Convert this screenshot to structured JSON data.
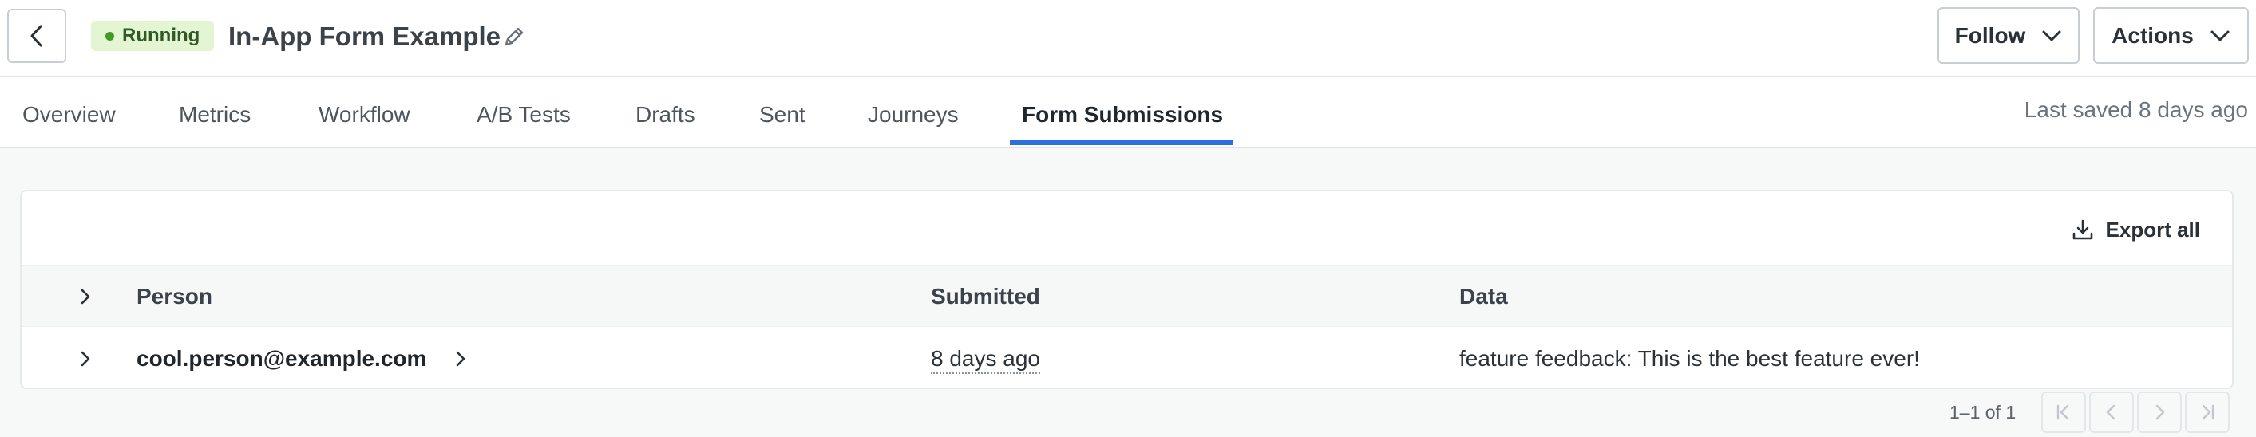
{
  "header": {
    "status": "Running",
    "title": "In-App Form Example",
    "follow_label": "Follow",
    "actions_label": "Actions"
  },
  "tabs": [
    {
      "label": "Overview"
    },
    {
      "label": "Metrics"
    },
    {
      "label": "Workflow"
    },
    {
      "label": "A/B Tests"
    },
    {
      "label": "Drafts"
    },
    {
      "label": "Sent"
    },
    {
      "label": "Journeys"
    },
    {
      "label": "Form Submissions",
      "active": true
    }
  ],
  "last_saved": "Last saved 8 days ago",
  "card": {
    "export_label": "Export all",
    "columns": [
      "Person",
      "Submitted",
      "Data"
    ],
    "rows": [
      {
        "person": "cool.person@example.com",
        "submitted": "8 days ago",
        "data": "feature feedback: This is the best feature ever!"
      }
    ]
  },
  "pagination": {
    "summary": "1–1 of 1"
  },
  "colors": {
    "accent": "#2c6fe0",
    "status_bg": "#e3f5d2",
    "status_dot": "#3f9a2c"
  }
}
